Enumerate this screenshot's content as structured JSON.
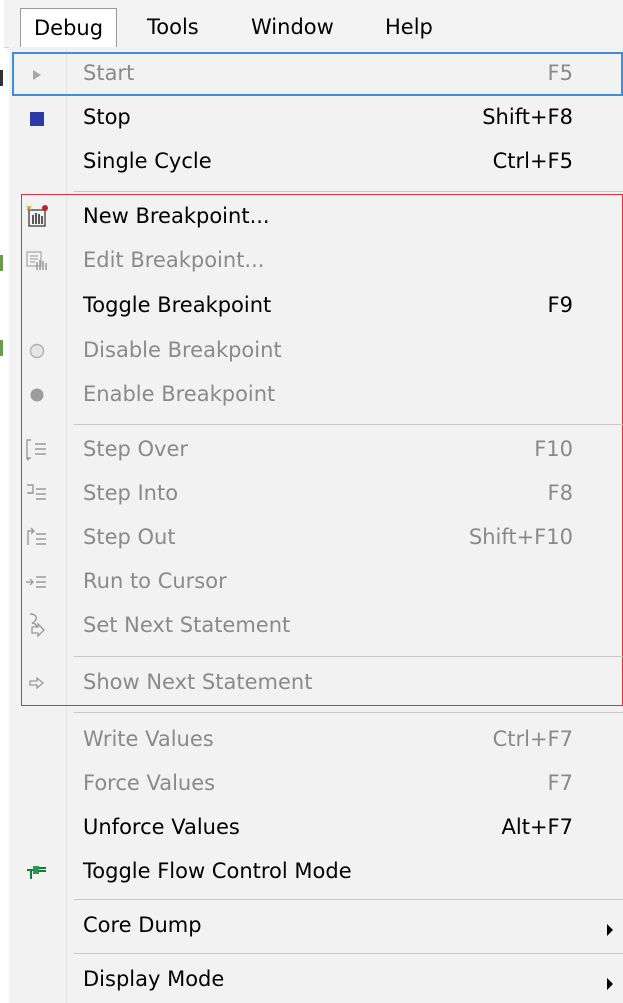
{
  "menubar": {
    "items": [
      {
        "label": "Debug",
        "active": true
      },
      {
        "label": "Tools"
      },
      {
        "label": "Window"
      },
      {
        "label": "Help"
      }
    ]
  },
  "menu": {
    "items": [
      {
        "id": "start",
        "label": "Start",
        "shortcut": "F5",
        "enabled": false,
        "icon": "play-icon"
      },
      {
        "id": "stop",
        "label": "Stop",
        "shortcut": "Shift+F8",
        "enabled": true,
        "icon": "stop-icon"
      },
      {
        "id": "single-cycle",
        "label": "Single Cycle",
        "shortcut": "Ctrl+F5",
        "enabled": true
      },
      {
        "id": "new-breakpoint",
        "label": "New Breakpoint...",
        "shortcut": "",
        "enabled": true,
        "icon": "new-breakpoint-icon"
      },
      {
        "id": "edit-breakpoint",
        "label": "Edit Breakpoint...",
        "shortcut": "",
        "enabled": false,
        "icon": "edit-breakpoint-icon"
      },
      {
        "id": "toggle-breakpoint",
        "label": "Toggle Breakpoint",
        "shortcut": "F9",
        "enabled": true
      },
      {
        "id": "disable-breakpoint",
        "label": "Disable Breakpoint",
        "shortcut": "",
        "enabled": false,
        "icon": "hollow-circle-icon"
      },
      {
        "id": "enable-breakpoint",
        "label": "Enable Breakpoint",
        "shortcut": "",
        "enabled": false,
        "icon": "filled-circle-icon"
      },
      {
        "id": "step-over",
        "label": "Step Over",
        "shortcut": "F10",
        "enabled": false,
        "icon": "step-over-icon"
      },
      {
        "id": "step-into",
        "label": "Step Into",
        "shortcut": "F8",
        "enabled": false,
        "icon": "step-into-icon"
      },
      {
        "id": "step-out",
        "label": "Step Out",
        "shortcut": "Shift+F10",
        "enabled": false,
        "icon": "step-out-icon"
      },
      {
        "id": "run-to-cursor",
        "label": "Run to Cursor",
        "shortcut": "",
        "enabled": false,
        "icon": "run-to-cursor-icon"
      },
      {
        "id": "set-next-statement",
        "label": "Set Next Statement",
        "shortcut": "",
        "enabled": false,
        "icon": "set-next-statement-icon"
      },
      {
        "id": "show-next-statement",
        "label": "Show Next Statement",
        "shortcut": "",
        "enabled": false,
        "icon": "right-arrow-icon"
      },
      {
        "id": "write-values",
        "label": "Write Values",
        "shortcut": "Ctrl+F7",
        "enabled": false
      },
      {
        "id": "force-values",
        "label": "Force Values",
        "shortcut": "F7",
        "enabled": false
      },
      {
        "id": "unforce-values",
        "label": "Unforce Values",
        "shortcut": "Alt+F7",
        "enabled": true
      },
      {
        "id": "toggle-flow-control-mode",
        "label": "Toggle Flow Control Mode",
        "shortcut": "",
        "enabled": true,
        "icon": "flow-control-icon"
      },
      {
        "id": "core-dump",
        "label": "Core Dump",
        "shortcut": "",
        "enabled": true,
        "submenu": true
      },
      {
        "id": "display-mode",
        "label": "Display Mode",
        "shortcut": "",
        "enabled": true,
        "submenu": true
      }
    ]
  },
  "colors": {
    "highlight_border": "#3d8fd8",
    "annotation_border": "#e0303e",
    "stop_icon": "#2b3aa6",
    "disabled_text": "#8a8a8a"
  }
}
